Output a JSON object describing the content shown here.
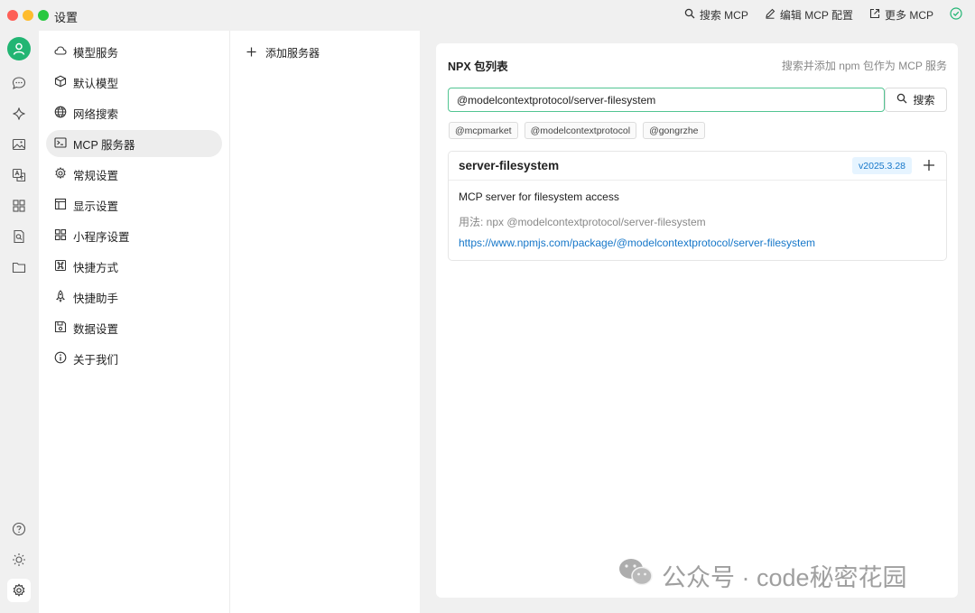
{
  "window": {
    "title": "设置"
  },
  "top_actions": {
    "search_mcp": "搜索 MCP",
    "edit_mcp_config": "编辑 MCP 配置",
    "more_mcp": "更多 MCP"
  },
  "rail": {
    "icons": [
      "avatar",
      "chat-icon",
      "sparkle-icon",
      "image-icon",
      "translate-icon",
      "apps-icon",
      "knowledge-icon",
      "folder-icon",
      "help-icon",
      "theme-icon",
      "settings-icon"
    ]
  },
  "settings_nav": {
    "items": [
      {
        "label": "模型服务",
        "icon": "cloud-icon"
      },
      {
        "label": "默认模型",
        "icon": "cube-icon"
      },
      {
        "label": "网络搜索",
        "icon": "globe-icon"
      },
      {
        "label": "MCP 服务器",
        "icon": "terminal-icon"
      },
      {
        "label": "常规设置",
        "icon": "gear-icon"
      },
      {
        "label": "显示设置",
        "icon": "layout-icon"
      },
      {
        "label": "小程序设置",
        "icon": "grid-icon"
      },
      {
        "label": "快捷方式",
        "icon": "command-icon"
      },
      {
        "label": "快捷助手",
        "icon": "rocket-icon"
      },
      {
        "label": "数据设置",
        "icon": "save-icon"
      },
      {
        "label": "关于我们",
        "icon": "info-icon"
      }
    ],
    "active": "MCP 服务器"
  },
  "server_list": {
    "add_label": "添加服务器"
  },
  "npx_panel": {
    "title": "NPX 包列表",
    "hint": "搜索并添加 npm 包作为 MCP 服务",
    "search_value": "@modelcontextprotocol/server-filesystem",
    "search_button": "搜索",
    "tags": [
      "@mcpmarket",
      "@modelcontextprotocol",
      "@gongrzhe"
    ],
    "result": {
      "name": "server-filesystem",
      "version": "v2025.3.28",
      "description": "MCP server for filesystem access",
      "usage": "用法: npx @modelcontextprotocol/server-filesystem",
      "link": "https://www.npmjs.com/package/@modelcontextprotocol/server-filesystem"
    }
  },
  "watermark": {
    "text": "公众号 · code秘密花园"
  },
  "colors": {
    "accent": "#22b573",
    "input_border": "#52c592",
    "link": "#1677c9",
    "version_bg": "#e6f4ff"
  }
}
